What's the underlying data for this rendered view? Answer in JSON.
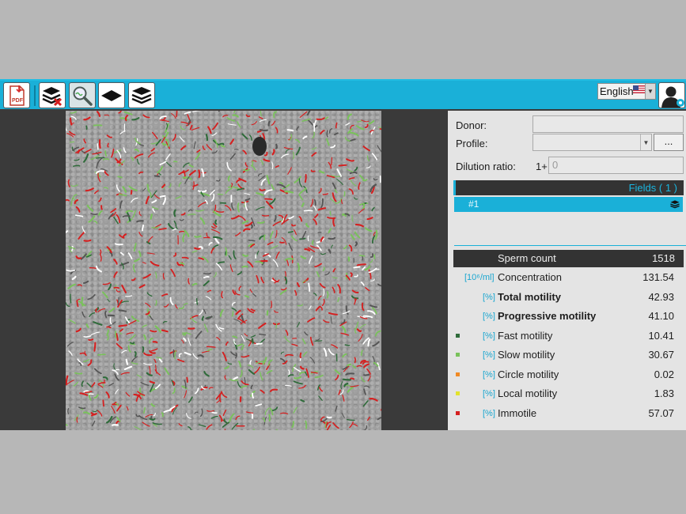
{
  "toolbar": {
    "buttons": [
      {
        "id": "pdf",
        "icon": "pdf-icon"
      },
      {
        "id": "delete-fields",
        "icon": "layers-delete-icon"
      },
      {
        "id": "analyze",
        "icon": "magnifier-icon"
      },
      {
        "id": "single-field",
        "icon": "single-layer-icon"
      },
      {
        "id": "all-fields",
        "icon": "layers-icon"
      }
    ],
    "pdf_label": "PDF",
    "language": "English",
    "user_icon": "user-settings-icon"
  },
  "form": {
    "donor_label": "Donor:",
    "donor_value": "",
    "profile_label": "Profile:",
    "profile_value": "",
    "profile_button": "...",
    "dilution_label": "Dilution ratio:",
    "dilution_prefix": "1+",
    "dilution_value": "0"
  },
  "fields": {
    "header": "Fields ( 1 )",
    "items": [
      {
        "label": "#1",
        "icon": "layers-icon"
      }
    ]
  },
  "stats": {
    "header": {
      "name": "Sperm count",
      "value": "1518"
    },
    "rows": [
      {
        "unit": "[10⁶/ml]",
        "name": "Concentration",
        "value": "131.54",
        "bold": false,
        "bullet": ""
      },
      {
        "unit": "[%]",
        "name": "Total motility",
        "value": "42.93",
        "bold": true,
        "bullet": ""
      },
      {
        "unit": "[%]",
        "name": "Progressive motility",
        "value": "41.10",
        "bold": true,
        "bullet": ""
      },
      {
        "unit": "[%]",
        "name": "Fast motility",
        "value": "10.41",
        "bold": false,
        "bullet": "#2f6b3a"
      },
      {
        "unit": "[%]",
        "name": "Slow motility",
        "value": "30.67",
        "bold": false,
        "bullet": "#79c25a"
      },
      {
        "unit": "[%]",
        "name": "Circle motility",
        "value": "0.02",
        "bold": false,
        "bullet": "#f08a24"
      },
      {
        "unit": "[%]",
        "name": "Local motility",
        "value": "1.83",
        "bold": false,
        "bullet": "#e2e32c"
      },
      {
        "unit": "[%]",
        "name": "Immotile",
        "value": "57.07",
        "bold": false,
        "bullet": "#d52020"
      }
    ]
  },
  "colors": {
    "accent": "#1ab0d8",
    "fast": "#2f6b3a",
    "slow": "#79c25a",
    "immotile": "#d52020"
  }
}
